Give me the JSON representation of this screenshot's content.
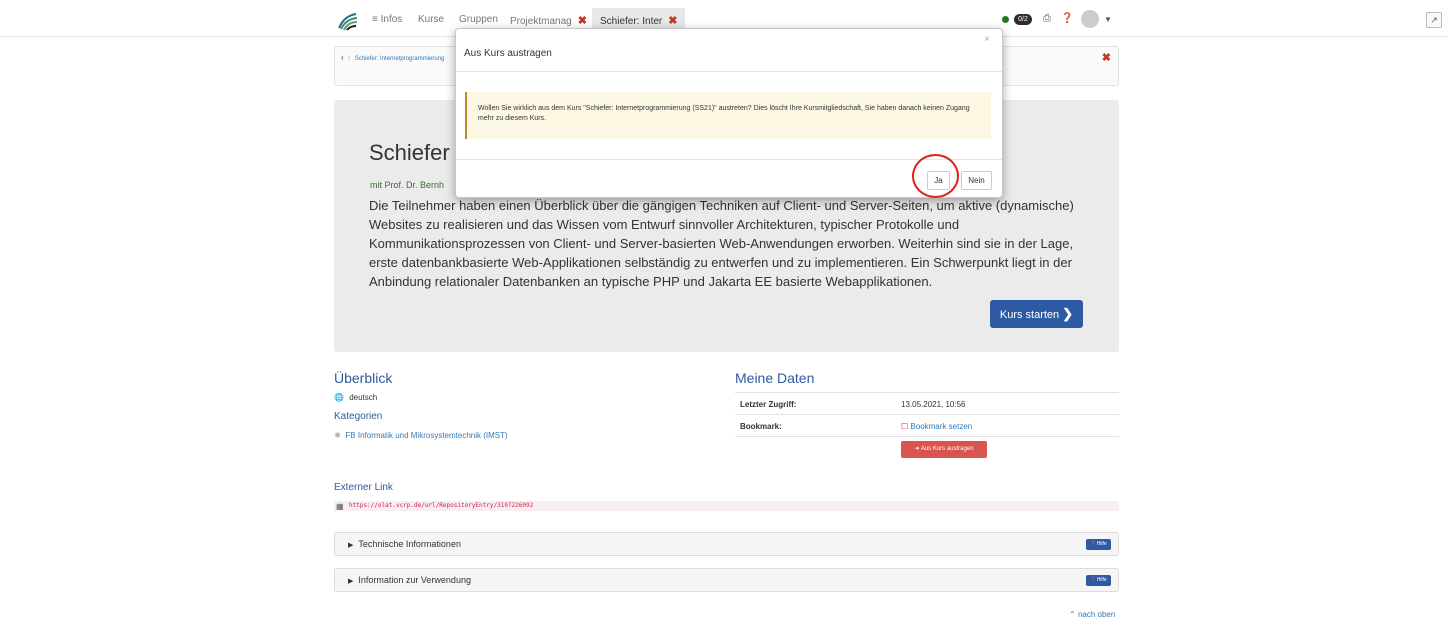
{
  "topbar": {
    "tabs": [
      {
        "label": "≡ Infos"
      },
      {
        "label": "Kurse"
      },
      {
        "label": "Gruppen"
      },
      {
        "label": "Projektmanag"
      },
      {
        "label": "Schiefer: Inter"
      }
    ],
    "close_glyph": "✖",
    "badge": "0/2",
    "icons": {
      "print": "print-icon",
      "help": "help-icon",
      "expand": "expand-icon"
    }
  },
  "breadcrumb": {
    "back": "‹",
    "sep": "/",
    "current": "Schiefer: Internetprogrammierung"
  },
  "hero": {
    "title": "Schiefer",
    "subtitle": "mit Prof. Dr. Bernh",
    "description": "Die Teilnehmer haben einen Überblick über die gängigen Techniken auf Client- und Server-Seiten, um aktive (dynamische) Websites zu realisieren und das Wissen vom Entwurf sinnvoller Architekturen, typischer Protokolle und Kommunikationsprozessen von Client- und Server-basierten Web-Anwendungen erworben. Weiterhin sind sie in der Lage, erste datenbankbasierte Web-Applikationen selbständig zu entwerfen und zu implementieren. Ein Schwerpunkt liegt in der Anbindung relationaler Datenbanken an typische PHP und Jakarta EE basierte Webapplikationen.",
    "start_button": "Kurs starten"
  },
  "overview": {
    "heading": "Überblick",
    "language": "deutsch",
    "categories_heading": "Kategorien",
    "category": "FB Informatik und Mikrosystemtechnik (IMST)"
  },
  "my_data": {
    "heading": "Meine Daten",
    "last_access_label": "Letzter Zugriff:",
    "last_access_value": "13.05.2021, 10:56",
    "bookmark_label": "Bookmark:",
    "bookmark_value": "Bookmark setzen",
    "leave_button": "Aus Kurs austragen"
  },
  "external_link": {
    "heading": "Externer Link",
    "url": "https://olat.vcrp.de/url/RepositoryEntry/3107226092"
  },
  "panels": [
    {
      "label": "Technische Informationen",
      "help": "Hilfe"
    },
    {
      "label": "Information zur Verwendung",
      "help": "Hilfe"
    }
  ],
  "back_to_top": "nach oben",
  "modal": {
    "title": "Aus Kurs austragen",
    "close": "×",
    "message": "Wollen Sie wirklich aus dem Kurs \"Schiefer: Internetprogrammierung (SS21)\" austreten? Dies löscht Ihre Kursmitgliedschaft, Sie haben danach keinen Zugang mehr zu diesem Kurs.",
    "yes": "Ja",
    "no": "Nein"
  },
  "colors": {
    "accent": "#2e5aa3",
    "danger": "#d9534f",
    "warning_bg": "#fcf8e3",
    "highlight_ring": "#e02020"
  }
}
